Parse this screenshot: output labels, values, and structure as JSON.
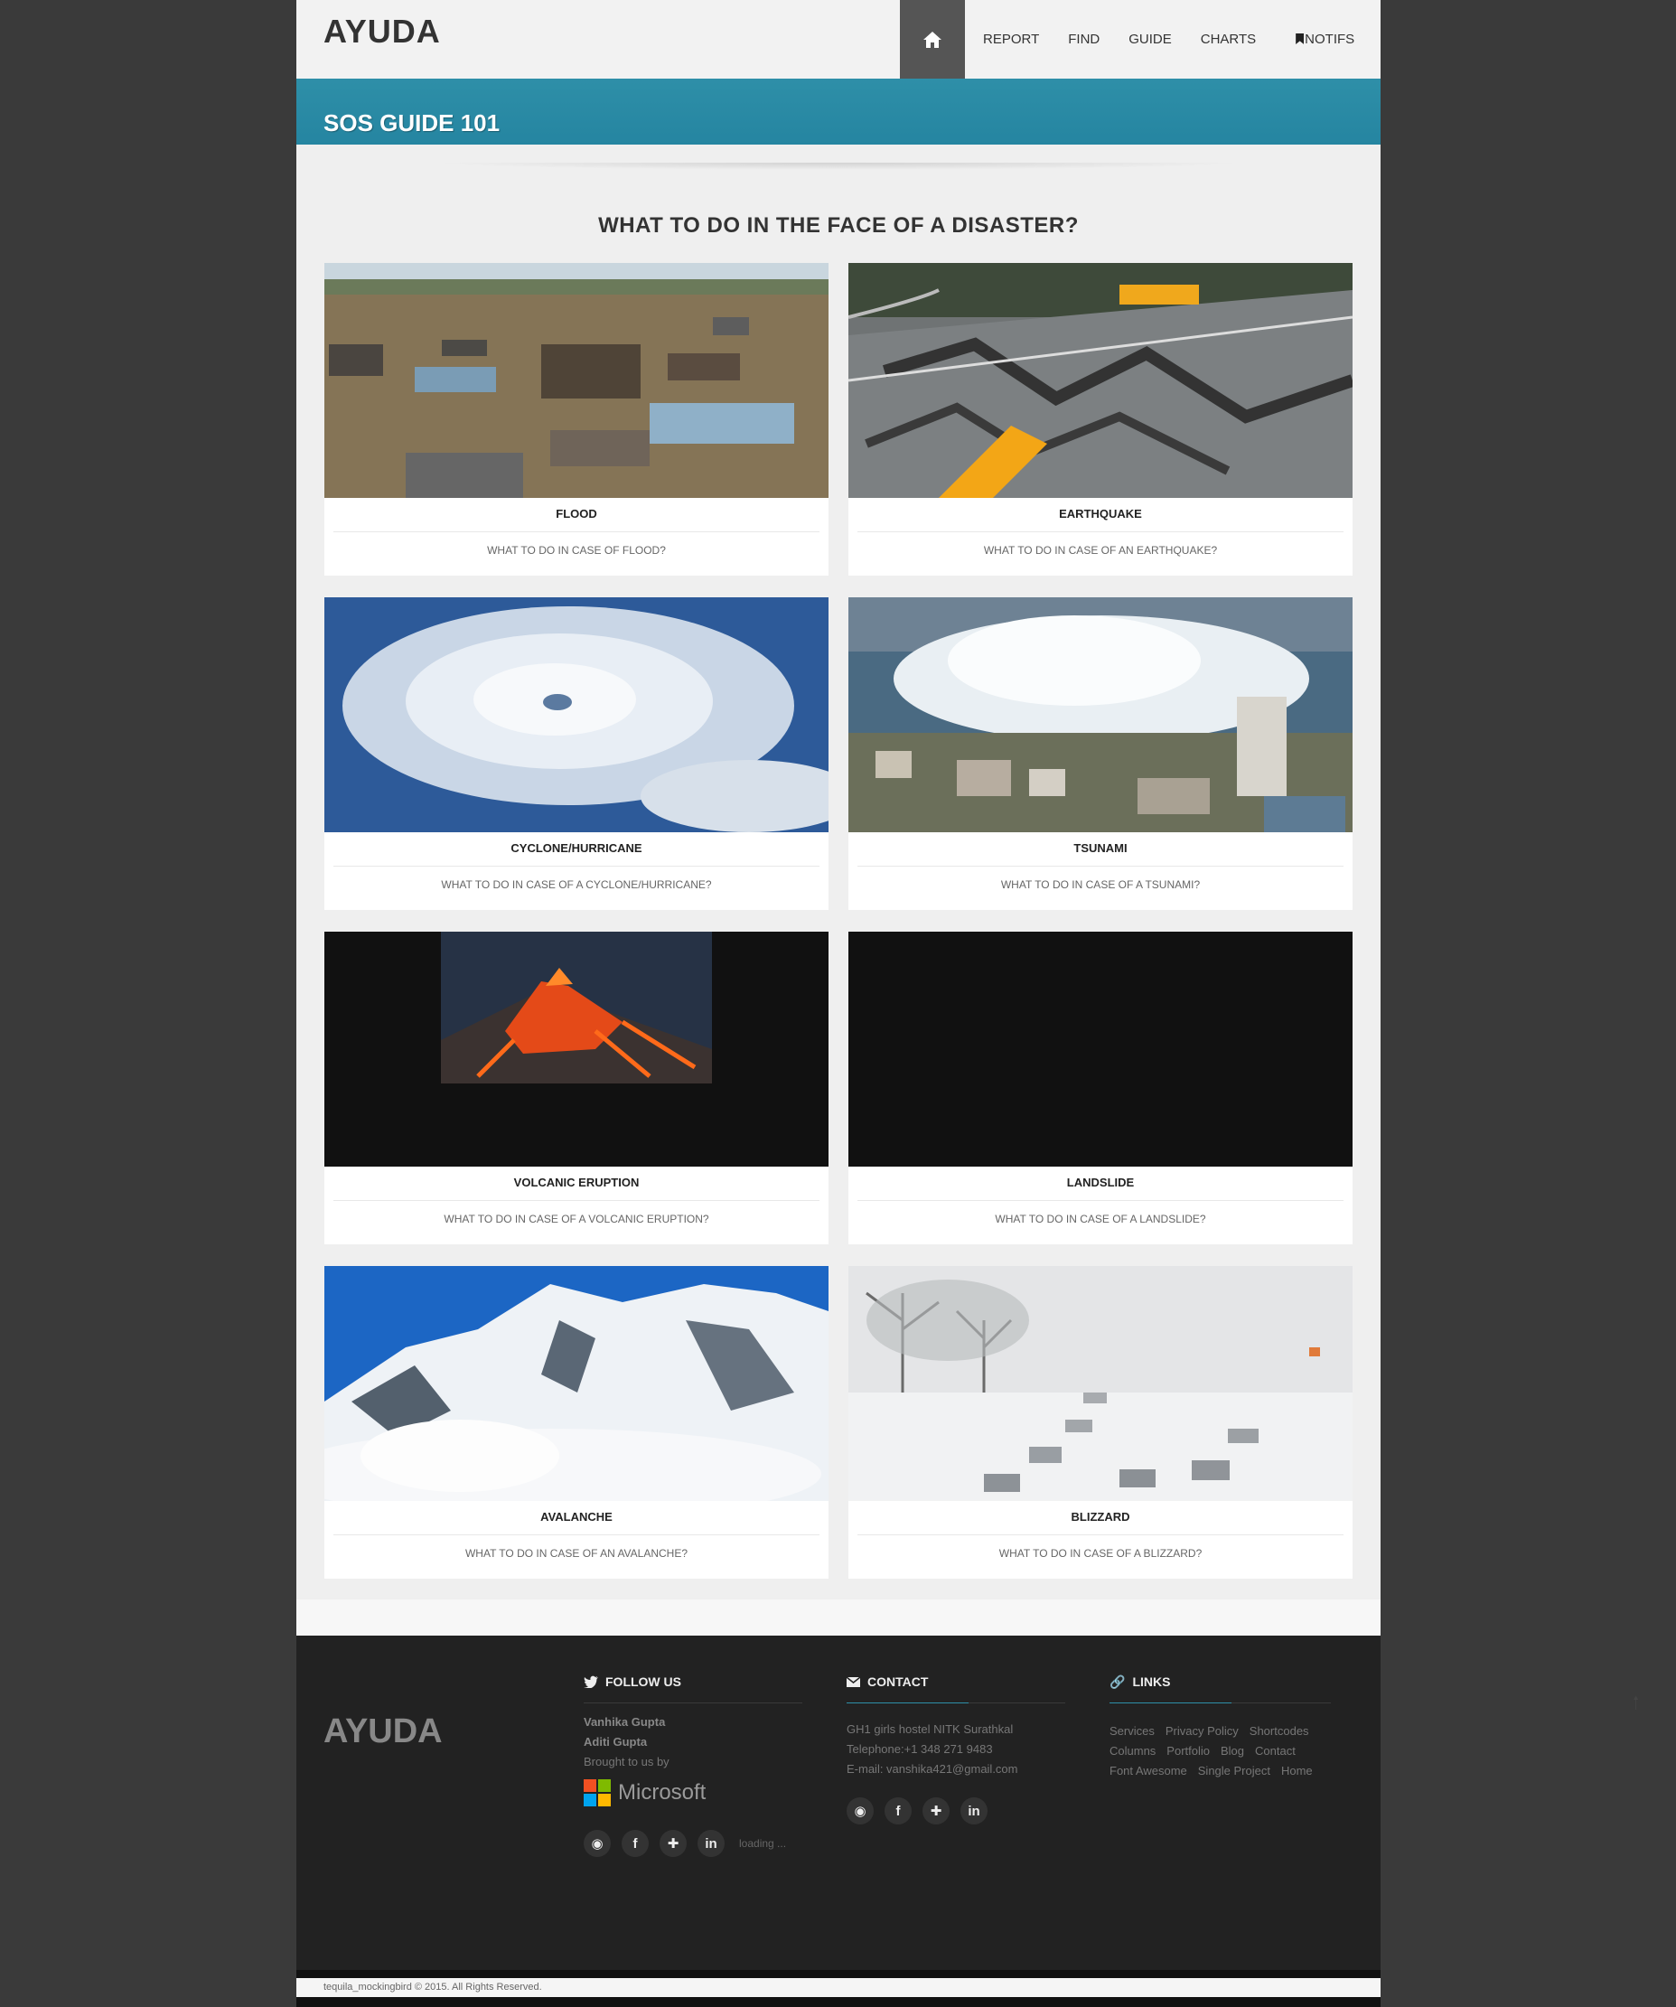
{
  "header": {
    "logo": "AYUDA",
    "nav": [
      {
        "label": "REPORT"
      },
      {
        "label": "FIND"
      },
      {
        "label": "GUIDE"
      },
      {
        "label": "CHARTS"
      },
      {
        "label": "NOTIFS"
      }
    ]
  },
  "banner": {
    "title": "SOS GUIDE 101"
  },
  "section": {
    "title": "WHAT TO DO IN THE FACE OF A DISASTER?"
  },
  "cards": [
    {
      "title": "FLOOD",
      "subtitle": "WHAT TO DO IN CASE OF FLOOD?"
    },
    {
      "title": "EARTHQUAKE",
      "subtitle": "WHAT TO DO IN CASE OF AN EARTHQUAKE?"
    },
    {
      "title": "CYCLONE/HURRICANE",
      "subtitle": "WHAT TO DO IN CASE OF A CYCLONE/HURRICANE?"
    },
    {
      "title": "TSUNAMI",
      "subtitle": "WHAT TO DO IN CASE OF A TSUNAMI?"
    },
    {
      "title": "VOLCANIC ERUPTION",
      "subtitle": "WHAT TO DO IN CASE OF A VOLCANIC ERUPTION?"
    },
    {
      "title": "LANDSLIDE",
      "subtitle": "WHAT TO DO IN CASE OF A LANDSLIDE?"
    },
    {
      "title": "AVALANCHE",
      "subtitle": "WHAT TO DO IN CASE OF AN AVALANCHE?"
    },
    {
      "title": "BLIZZARD",
      "subtitle": "WHAT TO DO IN CASE OF A BLIZZARD?"
    }
  ],
  "footer": {
    "logo": "AYUDA",
    "follow": {
      "heading": "FOLLOW US",
      "names": [
        "Vanhika Gupta",
        "Aditi Gupta"
      ],
      "brought": "Brought to us by",
      "sponsor": "Microsoft",
      "loading": "loading ..."
    },
    "contact": {
      "heading": "CONTACT",
      "address": "GH1 girls hostel NITK Surathkal",
      "phone": "Telephone:+1 348 271 9483",
      "email": "E-mail: vanshika421@gmail.com"
    },
    "links": {
      "heading": "LINKS",
      "items": [
        "Services",
        "Privacy Policy",
        "Shortcodes",
        "Columns",
        "Portfolio",
        "Blog",
        "Contact",
        "Font Awesome",
        "Single Project",
        "Home"
      ]
    },
    "copyright": "tequila_mockingbird © 2015. All Rights Reserved."
  },
  "colors": {
    "accent": "#2e8fa8",
    "footer_bg": "#222222",
    "page_bg": "#3a3a3a"
  }
}
